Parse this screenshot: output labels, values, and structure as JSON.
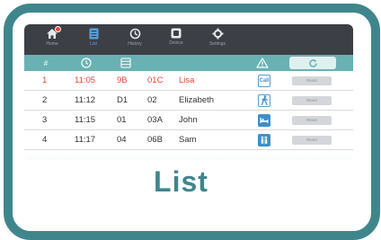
{
  "nav": {
    "items": [
      {
        "label": "Home",
        "icon": "home-icon"
      },
      {
        "label": "List",
        "icon": "list-icon",
        "active": true
      },
      {
        "label": "History",
        "icon": "history-icon"
      },
      {
        "label": "Device",
        "icon": "device-icon"
      },
      {
        "label": "Settings",
        "icon": "gear-icon"
      }
    ]
  },
  "table": {
    "header": {
      "number": "#",
      "time_icon": "clock-icon",
      "room_icon": "table-icon",
      "status_icon": "warning-icon",
      "refresh_icon": "refresh-icon"
    },
    "rows": [
      {
        "num": "1",
        "time": "11:05",
        "room": "9B",
        "bed": "01C",
        "name": "Lisa",
        "status": "Call",
        "status_icon": "call-icon",
        "reset": "Reset",
        "alert": true
      },
      {
        "num": "2",
        "time": "11:12",
        "room": "D1",
        "bed": "02",
        "name": "Elizabeth",
        "status": "",
        "status_icon": "walking-person-icon",
        "reset": "Reset",
        "alert": false
      },
      {
        "num": "3",
        "time": "11:15",
        "room": "01",
        "bed": "03A",
        "name": "John",
        "status": "",
        "status_icon": "bed-icon",
        "reset": "Reset",
        "alert": false
      },
      {
        "num": "4",
        "time": "11:17",
        "room": "04",
        "bed": "06B",
        "name": "Sam",
        "status": "",
        "status_icon": "bathroom-icon",
        "reset": "Reset",
        "alert": false
      }
    ]
  },
  "caption": "List",
  "colors": {
    "frame": "#3f868c",
    "nav_bg": "#3d3f46",
    "header_bg": "#6ab1b3",
    "alert": "#e8453c",
    "accent": "#3e8fc9"
  }
}
